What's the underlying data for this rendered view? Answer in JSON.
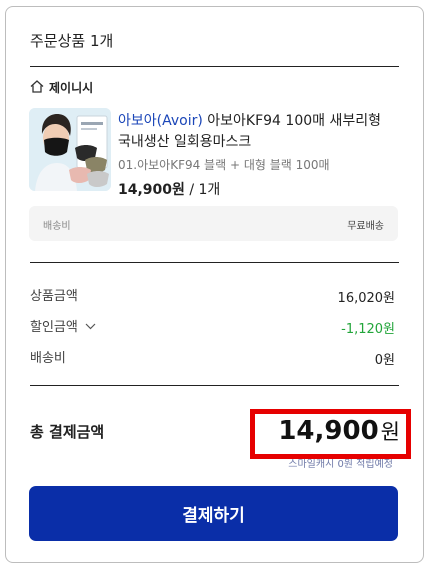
{
  "header": {
    "title": "주문상품 1개"
  },
  "store": {
    "name": "제이니시",
    "icon": "home-icon"
  },
  "product": {
    "brand": "아보아(Avoir)",
    "name": "아보아KF94 100매 새부리형 국내생산 일회용마스크",
    "option": "01.아보아KF94 블랙 + 대형 블랙 100매",
    "price": "14,900원",
    "quantity": "/ 1개",
    "image_alt": "마스크 착용 모델 이미지"
  },
  "shipping_box": {
    "label": "배송비",
    "value": "무료배송"
  },
  "summary": {
    "product_amount_label": "상품금액",
    "product_amount_value": "16,020원",
    "discount_label": "할인금액",
    "discount_value": "-1,120원",
    "shipping_label": "배송비",
    "shipping_value": "0원"
  },
  "total": {
    "label": "총 결제금액",
    "amount": "14,900",
    "unit": "원",
    "points_note": "스마일캐시 0원 적립예정"
  },
  "pay_button": {
    "label": "결제하기"
  },
  "colors": {
    "accent": "#0a2ea8",
    "highlight": "#e60000",
    "discount": "#22a53a",
    "brand_link": "#1b46b8"
  }
}
